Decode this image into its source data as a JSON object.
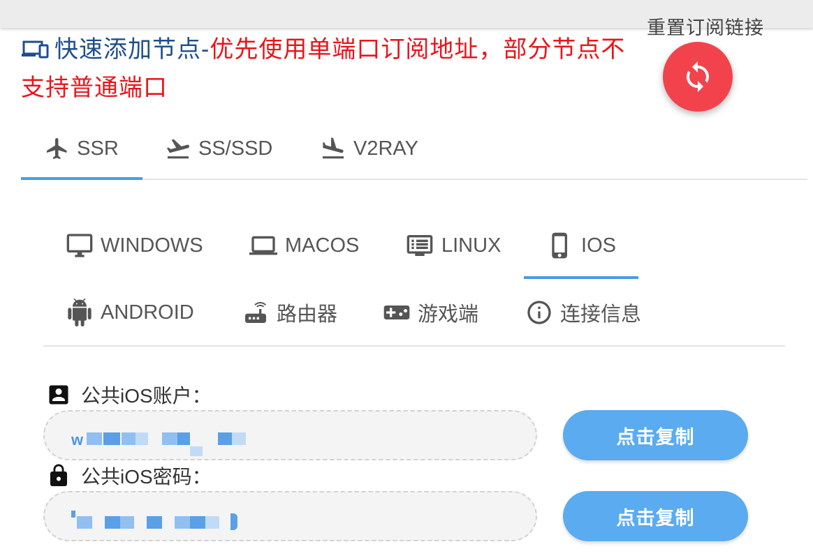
{
  "header": {
    "title_blue": "快速添加节点-",
    "title_red": "优先使用单端口订阅地址，部分节点不支持普通端口",
    "icon": "devices-icon",
    "colors": {
      "blue": "#1f4e8c",
      "red": "#e8151b"
    }
  },
  "reset": {
    "label": "重置订阅链接",
    "icon": "refresh-icon",
    "color": "#f2434d"
  },
  "protocol_tabs": [
    {
      "label": "SSR",
      "icon": "airplane-icon",
      "active": true
    },
    {
      "label": "SS/SSD",
      "icon": "flight-takeoff-icon",
      "active": false
    },
    {
      "label": "V2RAY",
      "icon": "flight-land-icon",
      "active": false
    }
  ],
  "platform_tabs": [
    {
      "label": "WINDOWS",
      "icon": "desktop-icon",
      "active": false
    },
    {
      "label": "MACOS",
      "icon": "laptop-icon",
      "active": false
    },
    {
      "label": "LINUX",
      "icon": "terminal-list-icon",
      "active": false
    },
    {
      "label": "IOS",
      "icon": "phone-icon",
      "active": true
    },
    {
      "label": "ANDROID",
      "icon": "android-icon",
      "active": false
    },
    {
      "label": "路由器",
      "icon": "router-icon",
      "active": false
    },
    {
      "label": "游戏端",
      "icon": "gamepad-icon",
      "active": false
    },
    {
      "label": "连接信息",
      "icon": "info-icon",
      "active": false
    }
  ],
  "account": {
    "label": "公共iOS账户：",
    "icon": "account-box-icon",
    "value_visible": "w",
    "copy_label": "点击复制"
  },
  "password": {
    "label": "公共iOS密码：",
    "icon": "lock-icon",
    "copy_label": "点击复制"
  },
  "accent_color": "#4a9be5"
}
